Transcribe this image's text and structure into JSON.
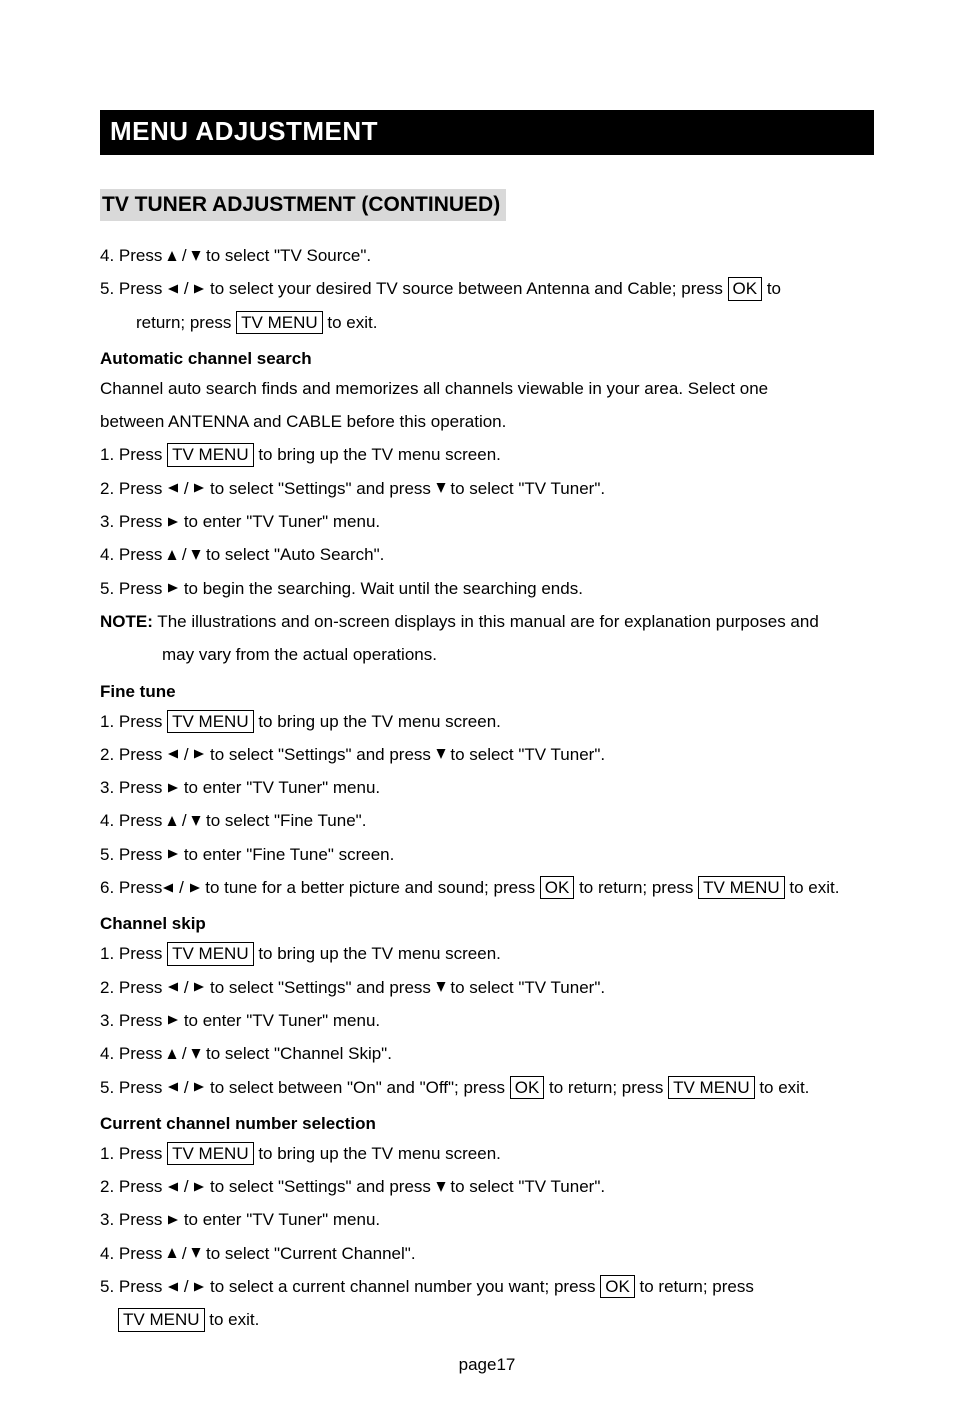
{
  "title": "MENU ADJUSTMENT",
  "subheading": "TV TUNER ADJUSTMENT (CONTINUED)",
  "buttons": {
    "ok": "OK",
    "tvmenu": "TV MENU"
  },
  "contSteps": {
    "s4_a": "4. Press ",
    "s4_b": " / ",
    "s4_c": " to select \"TV Source\".",
    "s5_a": "5. Press ",
    "s5_b": " / ",
    "s5_c": " to select your desired TV source between Antenna and Cable; press ",
    "s5_d": " to",
    "s5_e": "return; press ",
    "s5_f": " to exit."
  },
  "auto": {
    "title": "Automatic channel search",
    "intro1": "Channel auto search finds and memorizes all channels viewable in your area. Select one",
    "intro2": "between ANTENNA and CABLE before this operation.",
    "s1_a": "1. Press ",
    "s1_b": " to bring up the TV menu screen.",
    "s2_a": "2. Press ",
    "s2_b": " / ",
    "s2_c": " to select \"Settings\" and press ",
    "s2_d": " to select \"TV Tuner\".",
    "s3_a": "3. Press ",
    "s3_b": " to enter \"TV Tuner\" menu.",
    "s4_a": "4. Press ",
    "s4_b": " / ",
    "s4_c": " to select \"Auto Search\".",
    "s5_a": "5. Press ",
    "s5_b": " to begin the searching. Wait until the searching ends.",
    "note_label": "NOTE:",
    "note1": " The illustrations and on-screen displays in this manual are for explanation purposes and",
    "note2": "may vary from the actual operations."
  },
  "fine": {
    "title": "Fine tune",
    "s1_a": "1. Press ",
    "s1_b": " to bring up the TV menu screen.",
    "s2_a": "2. Press ",
    "s2_b": " / ",
    "s2_c": " to select \"Settings\" and press ",
    "s2_d": " to select \"TV Tuner\".",
    "s3_a": "3. Press ",
    "s3_b": " to enter \"TV Tuner\" menu.",
    "s4_a": "4. Press  ",
    "s4_b": " / ",
    "s4_c": " to select \"Fine Tune\".",
    "s5_a": "5. Press ",
    "s5_b": "  to enter \"Fine Tune\" screen.",
    "s6_a": "6. Press",
    "s6_b": " / ",
    "s6_c": " to tune for a better picture and sound; press ",
    "s6_d": " to return; press ",
    "s6_e": " to exit."
  },
  "skip": {
    "title": "Channel skip",
    "s1_a": "1. Press ",
    "s1_b": " to bring up the TV menu screen.",
    "s2_a": "2. Press ",
    "s2_b": " / ",
    "s2_c": " to select \"Settings\" and press ",
    "s2_d": "  to select \"TV Tuner\".",
    "s3_a": "3. Press ",
    "s3_b": " to enter \"TV Tuner\" menu.",
    "s4_a": "4. Press  ",
    "s4_b": " /  ",
    "s4_c": " to select \"Channel Skip\".",
    "s5_a": "5. Press  ",
    "s5_b": " / ",
    "s5_c": " to select between \"On\" and \"Off\"; press ",
    "s5_d": " to return; press ",
    "s5_e": " to exit."
  },
  "current": {
    "title": "Current channel number selection",
    "s1_a": "1. Press ",
    "s1_b": " to bring up the TV menu screen.",
    "s2_a": "2. Press ",
    "s2_b": " / ",
    "s2_c": " to select \"Settings\" and press  ",
    "s2_d": " to select \"TV Tuner\".",
    "s3_a": "3. Press  ",
    "s3_b": " to enter \"TV Tuner\" menu.",
    "s4_a": "4. Press  ",
    "s4_b": " /  ",
    "s4_c": " to select \"Current Channel\".",
    "s5_a": "5. Press  ",
    "s5_b": " /  ",
    "s5_c": " to select a current channel number you want; press ",
    "s5_d": " to return; press",
    "s5_e": "  to exit."
  },
  "footer": "page17"
}
